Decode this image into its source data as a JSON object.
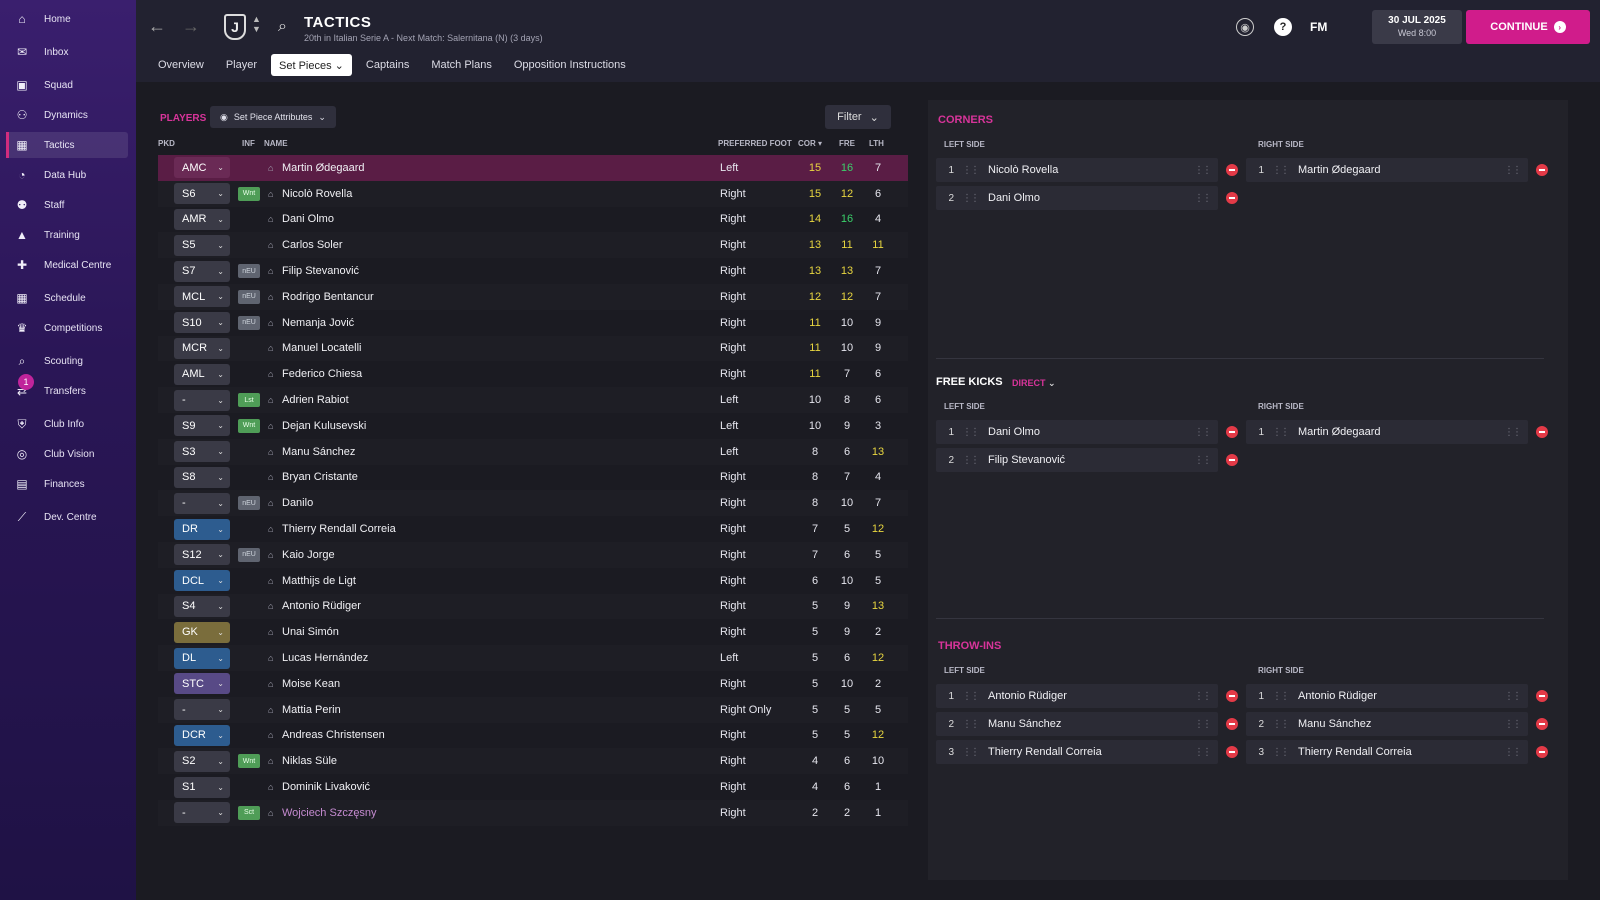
{
  "sidebar": {
    "items": [
      {
        "label": "Home",
        "icon": "home-icon"
      },
      {
        "label": "Inbox",
        "icon": "inbox-icon"
      },
      {
        "label": "Squad",
        "icon": "squad-icon"
      },
      {
        "label": "Dynamics",
        "icon": "dynamics-icon"
      },
      {
        "label": "Tactics",
        "icon": "tactics-icon",
        "active": true
      },
      {
        "label": "Data Hub",
        "icon": "data-hub-icon"
      },
      {
        "label": "Staff",
        "icon": "staff-icon"
      },
      {
        "label": "Training",
        "icon": "training-icon"
      },
      {
        "label": "Medical Centre",
        "icon": "medical-icon"
      },
      {
        "label": "Schedule",
        "icon": "calendar-icon"
      },
      {
        "label": "Competitions",
        "icon": "trophy-icon"
      },
      {
        "label": "Scouting",
        "icon": "search-icon"
      },
      {
        "label": "Transfers",
        "icon": "transfers-icon",
        "badge": "1"
      },
      {
        "label": "Club Info",
        "icon": "shield-icon"
      },
      {
        "label": "Club Vision",
        "icon": "vision-icon"
      },
      {
        "label": "Finances",
        "icon": "money-icon"
      },
      {
        "label": "Dev. Centre",
        "icon": "dev-centre-icon"
      }
    ]
  },
  "header": {
    "title": "TACTICS",
    "subtitle": "20th in Italian Serie A - Next Match: Salernitana (N) (3 days)",
    "fm_label": "FM",
    "date": "30 JUL 2025",
    "time": "Wed 8:00",
    "continue_label": "CONTINUE",
    "club_initial": "J"
  },
  "tabs": [
    "Overview",
    "Player",
    "Set Pieces",
    "Captains",
    "Match Plans",
    "Opposition Instructions"
  ],
  "players_panel": {
    "label": "PLAYERS",
    "view_button": "Set Piece Attributes",
    "filter_label": "Filter",
    "columns": {
      "pkd": "PKD",
      "inf": "INF",
      "name": "NAME",
      "foot": "PREFERRED FOOT",
      "cor": "COR",
      "fre": "FRE",
      "lth": "LTH"
    },
    "rows": [
      {
        "pos": "AMC",
        "inf": "",
        "name": "Martin Ødegaard",
        "foot": "Left",
        "cor": "15",
        "fre": "16",
        "lth": "7",
        "cc": "y",
        "fc": "g",
        "lc": "w",
        "pc": "mag",
        "sel": true
      },
      {
        "pos": "S6",
        "inf": "Wnt",
        "name": "Nicolò Rovella",
        "foot": "Right",
        "cor": "15",
        "fre": "12",
        "lth": "6",
        "cc": "y",
        "fc": "y",
        "lc": "w",
        "pc": ""
      },
      {
        "pos": "AMR",
        "inf": "",
        "name": "Dani Olmo",
        "foot": "Right",
        "cor": "14",
        "fre": "16",
        "lth": "4",
        "cc": "y",
        "fc": "g",
        "lc": "w",
        "pc": ""
      },
      {
        "pos": "S5",
        "inf": "",
        "name": "Carlos Soler",
        "foot": "Right",
        "cor": "13",
        "fre": "11",
        "lth": "11",
        "cc": "y",
        "fc": "y",
        "lc": "y",
        "pc": ""
      },
      {
        "pos": "S7",
        "inf": "nEU",
        "name": "Filip Stevanović",
        "foot": "Right",
        "cor": "13",
        "fre": "13",
        "lth": "7",
        "cc": "y",
        "fc": "y",
        "lc": "w",
        "pc": ""
      },
      {
        "pos": "MCL",
        "inf": "nEU",
        "name": "Rodrigo Bentancur",
        "foot": "Right",
        "cor": "12",
        "fre": "12",
        "lth": "7",
        "cc": "y",
        "fc": "y",
        "lc": "w",
        "pc": ""
      },
      {
        "pos": "S10",
        "inf": "nEU",
        "name": "Nemanja Jović",
        "foot": "Right",
        "cor": "11",
        "fre": "10",
        "lth": "9",
        "cc": "y",
        "fc": "w",
        "lc": "w",
        "pc": ""
      },
      {
        "pos": "MCR",
        "inf": "",
        "name": "Manuel Locatelli",
        "foot": "Right",
        "cor": "11",
        "fre": "10",
        "lth": "9",
        "cc": "y",
        "fc": "w",
        "lc": "w",
        "pc": ""
      },
      {
        "pos": "AML",
        "inf": "",
        "name": "Federico Chiesa",
        "foot": "Right",
        "cor": "11",
        "fre": "7",
        "lth": "6",
        "cc": "y",
        "fc": "w",
        "lc": "w",
        "pc": ""
      },
      {
        "pos": "-",
        "inf": "Lst",
        "name": "Adrien Rabiot",
        "foot": "Left",
        "cor": "10",
        "fre": "8",
        "lth": "6",
        "cc": "w",
        "fc": "w",
        "lc": "w",
        "pc": ""
      },
      {
        "pos": "S9",
        "inf": "Wnt",
        "name": "Dejan Kulusevski",
        "foot": "Left",
        "cor": "10",
        "fre": "9",
        "lth": "3",
        "cc": "w",
        "fc": "w",
        "lc": "w",
        "pc": ""
      },
      {
        "pos": "S3",
        "inf": "",
        "name": "Manu Sánchez",
        "foot": "Left",
        "cor": "8",
        "fre": "6",
        "lth": "13",
        "cc": "w",
        "fc": "w",
        "lc": "y",
        "pc": ""
      },
      {
        "pos": "S8",
        "inf": "",
        "name": "Bryan Cristante",
        "foot": "Right",
        "cor": "8",
        "fre": "7",
        "lth": "4",
        "cc": "w",
        "fc": "w",
        "lc": "w",
        "pc": ""
      },
      {
        "pos": "-",
        "inf": "nEU",
        "name": "Danilo",
        "foot": "Right",
        "cor": "8",
        "fre": "10",
        "lth": "7",
        "cc": "w",
        "fc": "w",
        "lc": "w",
        "pc": ""
      },
      {
        "pos": "DR",
        "inf": "",
        "name": "Thierry Rendall Correia",
        "foot": "Right",
        "cor": "7",
        "fre": "5",
        "lth": "12",
        "cc": "w",
        "fc": "w",
        "lc": "y",
        "pc": "blue"
      },
      {
        "pos": "S12",
        "inf": "nEU",
        "name": "Kaio Jorge",
        "foot": "Right",
        "cor": "7",
        "fre": "6",
        "lth": "5",
        "cc": "w",
        "fc": "w",
        "lc": "w",
        "pc": ""
      },
      {
        "pos": "DCL",
        "inf": "",
        "name": "Matthijs de Ligt",
        "foot": "Right",
        "cor": "6",
        "fre": "10",
        "lth": "5",
        "cc": "w",
        "fc": "w",
        "lc": "w",
        "pc": "blue"
      },
      {
        "pos": "S4",
        "inf": "",
        "name": "Antonio Rüdiger",
        "foot": "Right",
        "cor": "5",
        "fre": "9",
        "lth": "13",
        "cc": "w",
        "fc": "w",
        "lc": "y",
        "pc": ""
      },
      {
        "pos": "GK",
        "inf": "",
        "name": "Unai Simón",
        "foot": "Right",
        "cor": "5",
        "fre": "9",
        "lth": "2",
        "cc": "w",
        "fc": "w",
        "lc": "w",
        "pc": "gk"
      },
      {
        "pos": "DL",
        "inf": "",
        "name": "Lucas Hernández",
        "foot": "Left",
        "cor": "5",
        "fre": "6",
        "lth": "12",
        "cc": "w",
        "fc": "w",
        "lc": "y",
        "pc": "blue"
      },
      {
        "pos": "STC",
        "inf": "",
        "name": "Moise Kean",
        "foot": "Right",
        "cor": "5",
        "fre": "10",
        "lth": "2",
        "cc": "w",
        "fc": "w",
        "lc": "w",
        "pc": "purple"
      },
      {
        "pos": "-",
        "inf": "",
        "name": "Mattia Perin",
        "foot": "Right Only",
        "cor": "5",
        "fre": "5",
        "lth": "5",
        "cc": "w",
        "fc": "w",
        "lc": "w",
        "pc": ""
      },
      {
        "pos": "DCR",
        "inf": "",
        "name": "Andreas Christensen",
        "foot": "Right",
        "cor": "5",
        "fre": "5",
        "lth": "12",
        "cc": "w",
        "fc": "w",
        "lc": "y",
        "pc": "blue"
      },
      {
        "pos": "S2",
        "inf": "Wnt",
        "name": "Niklas Süle",
        "foot": "Right",
        "cor": "4",
        "fre": "6",
        "lth": "10",
        "cc": "w",
        "fc": "w",
        "lc": "w",
        "pc": ""
      },
      {
        "pos": "S1",
        "inf": "",
        "name": "Dominik Livaković",
        "foot": "Right",
        "cor": "4",
        "fre": "6",
        "lth": "1",
        "cc": "w",
        "fc": "w",
        "lc": "w",
        "pc": ""
      },
      {
        "pos": "-",
        "inf": "Sct",
        "name": "Wojciech Szczęsny",
        "foot": "Right",
        "cor": "2",
        "fre": "2",
        "lth": "1",
        "cc": "w",
        "fc": "w",
        "lc": "w",
        "pc": "",
        "link": true
      }
    ]
  },
  "set_pieces": {
    "left_side": "LEFT SIDE",
    "right_side": "RIGHT SIDE",
    "corners": {
      "title": "CORNERS",
      "left": [
        "Nicolò Rovella",
        "Dani Olmo"
      ],
      "right": [
        "Martin Ødegaard"
      ]
    },
    "free_kicks": {
      "title": "FREE KICKS",
      "mode": "DIRECT",
      "left": [
        "Dani Olmo",
        "Filip Stevanović"
      ],
      "right": [
        "Martin Ødegaard"
      ]
    },
    "throw_ins": {
      "title": "THROW-INS",
      "left": [
        "Antonio Rüdiger",
        "Manu Sánchez",
        "Thierry Rendall Correia"
      ],
      "right": [
        "Antonio Rüdiger",
        "Manu Sánchez",
        "Thierry Rendall Correia"
      ]
    }
  },
  "colors": {
    "accent": "#d01c8b",
    "yellow_stat": "#e8d640",
    "green_stat": "#3ad06a",
    "remove": "#e33a47"
  }
}
